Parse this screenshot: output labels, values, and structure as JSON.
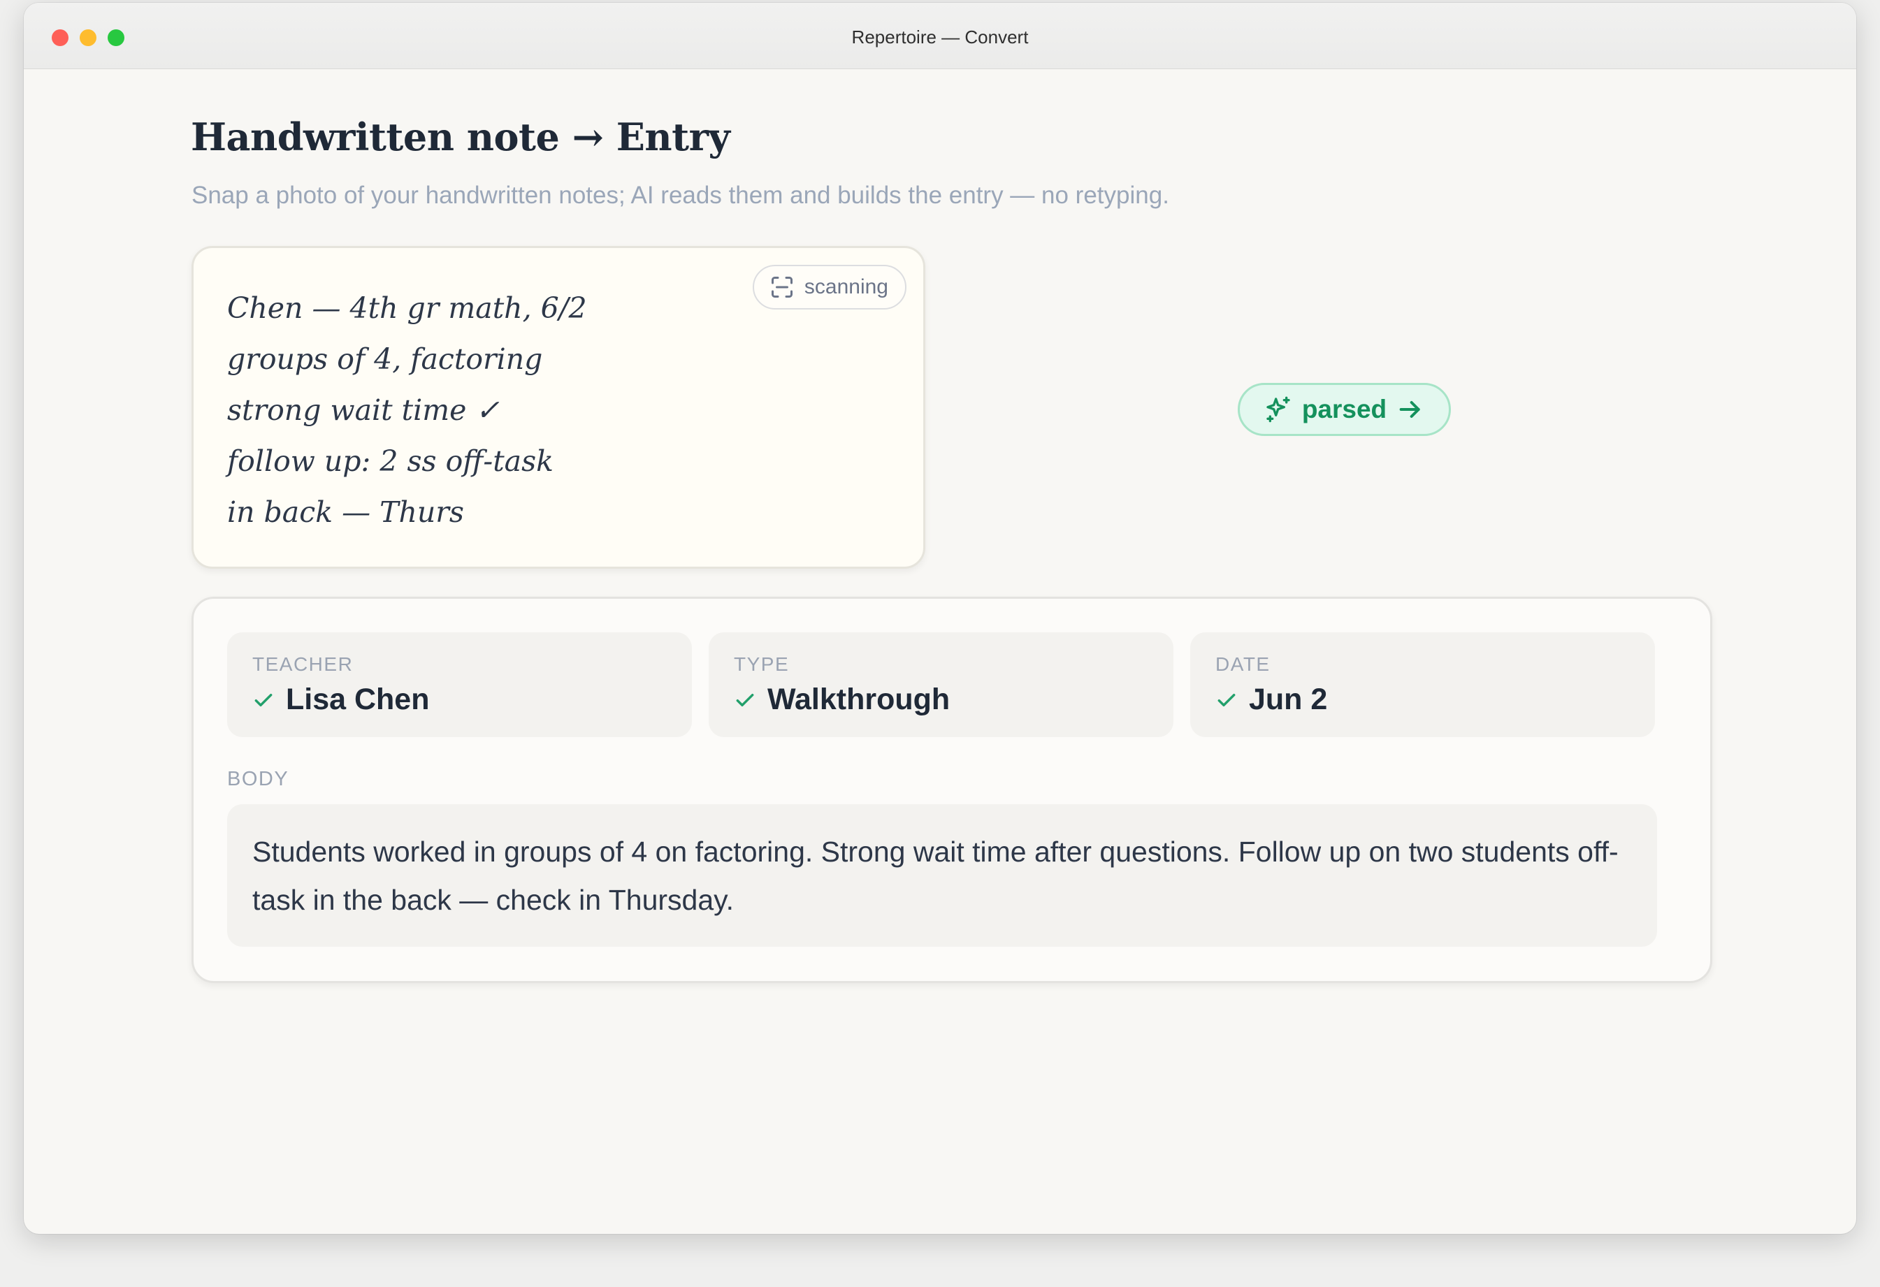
{
  "window": {
    "title": "Repertoire — Convert"
  },
  "header": {
    "title": "Handwritten note → Entry",
    "subtitle": "Snap a photo of your handwritten notes; AI reads them and builds the entry — no retyping."
  },
  "note": {
    "lines": [
      "Chen — 4th gr math, 6/2",
      "groups of 4, factoring",
      "strong wait time ✓",
      "follow up: 2 ss off-task",
      "in back — Thurs"
    ],
    "status_chip": {
      "label": "scanning",
      "icon": "scan-frame-icon"
    }
  },
  "parsed_chip": {
    "label": "parsed",
    "icon": "sparkles-icon",
    "trailing_icon": "arrow-right-icon"
  },
  "entry": {
    "fields": [
      {
        "label": "TEACHER",
        "value": "Lisa Chen",
        "status_icon": "check-icon"
      },
      {
        "label": "TYPE",
        "value": "Walkthrough",
        "status_icon": "check-icon"
      },
      {
        "label": "DATE",
        "value": "Jun 2",
        "status_icon": "check-icon"
      }
    ],
    "body_label": "BODY",
    "body_text": "Students worked in groups of 4 on factoring. Strong wait time after questions. Follow up on two students off-task in the back — check in Thursday."
  },
  "colors": {
    "accent_green": "#14915c",
    "check_green": "#22a06b",
    "muted_text": "#9aa6b8"
  }
}
